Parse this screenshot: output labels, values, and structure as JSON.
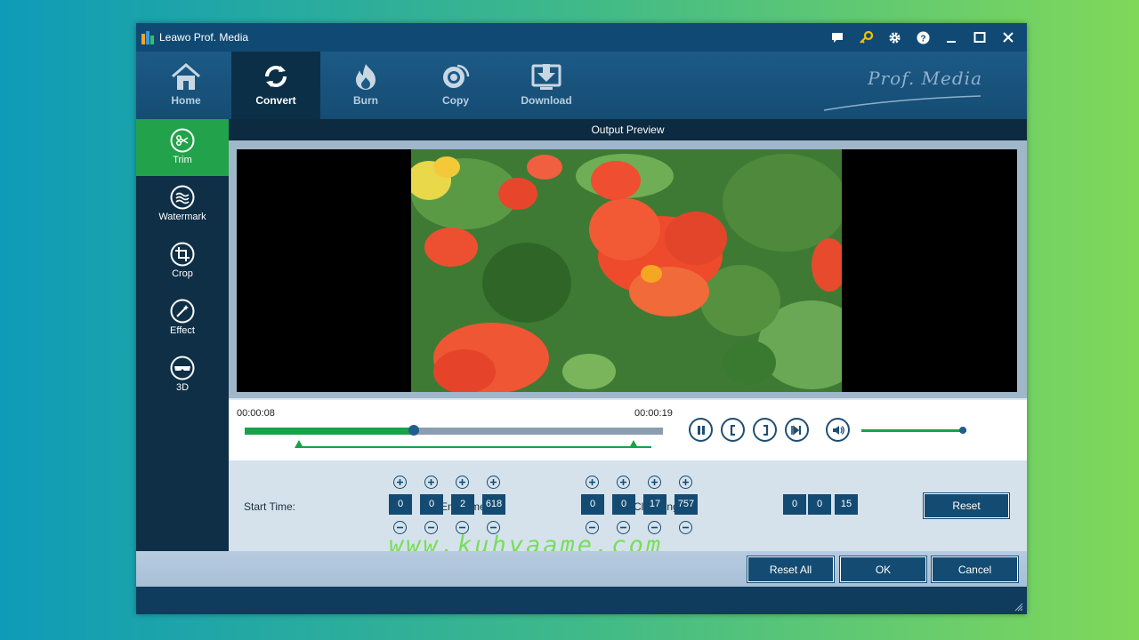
{
  "window": {
    "title": "Leawo Prof. Media"
  },
  "toolbar": {
    "items": [
      {
        "label": "Home",
        "icon": "home-icon"
      },
      {
        "label": "Convert",
        "icon": "convert-icon",
        "active": true
      },
      {
        "label": "Burn",
        "icon": "fire-icon"
      },
      {
        "label": "Copy",
        "icon": "disc-icon"
      },
      {
        "label": "Download",
        "icon": "download-icon"
      }
    ],
    "brand": "Prof. Media"
  },
  "sidebar": {
    "items": [
      {
        "label": "Trim",
        "icon": "scissors-icon",
        "active": true
      },
      {
        "label": "Watermark",
        "icon": "watermark-icon"
      },
      {
        "label": "Crop",
        "icon": "crop-icon"
      },
      {
        "label": "Effect",
        "icon": "effect-icon"
      },
      {
        "label": "3D",
        "icon": "3d-glasses-icon"
      }
    ]
  },
  "preview": {
    "header": "Output Preview"
  },
  "player": {
    "current_time": "00:00:08",
    "total_time": "00:00:19",
    "progress": 0.405,
    "trim_start": 0.13,
    "trim_end": 0.93,
    "volume": 0.97
  },
  "trim": {
    "start_label": "Start Time:",
    "start": [
      "0",
      "0",
      "2",
      "618"
    ],
    "end_label": "End Time:",
    "end": [
      "0",
      "0",
      "17",
      "757"
    ],
    "clip_label": "Clip Length:",
    "clip": [
      "0",
      "0",
      "15"
    ],
    "reset_label": "Reset"
  },
  "watermark_text": "www.kuhyaame.com",
  "footer": {
    "reset_all": "Reset All",
    "ok": "OK",
    "cancel": "Cancel"
  },
  "colors": {
    "accent": "#16a34a",
    "primary": "#134b72"
  }
}
